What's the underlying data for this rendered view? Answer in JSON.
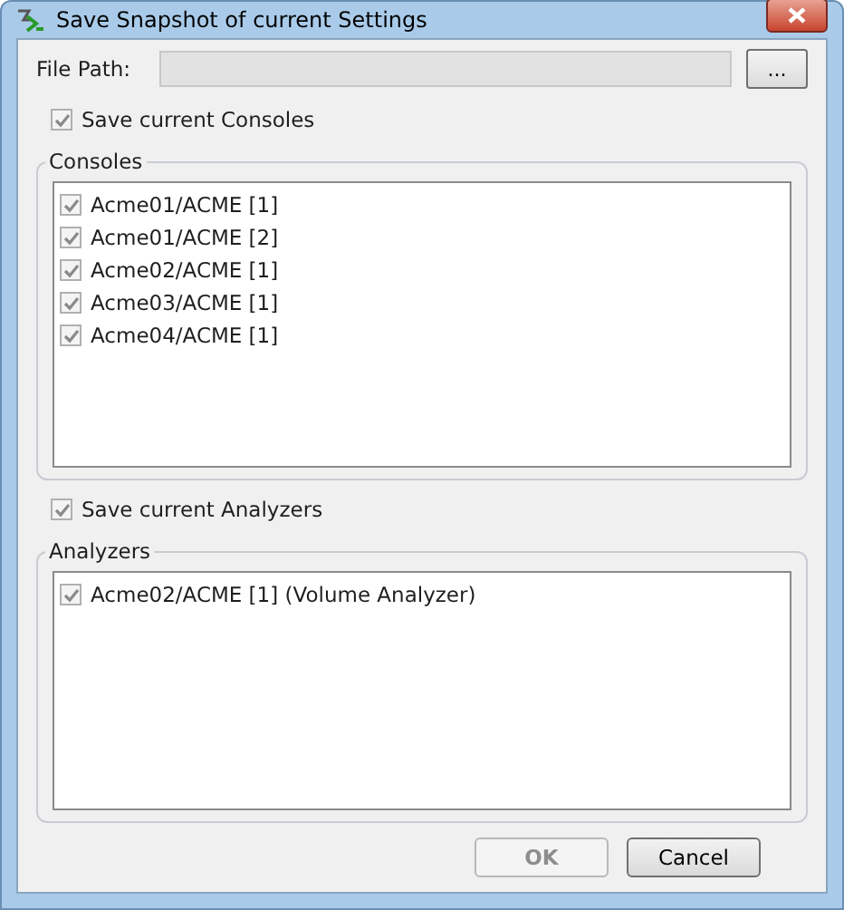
{
  "window": {
    "title": "Save Snapshot of current Settings"
  },
  "file_path": {
    "label": "File Path:",
    "disabled": true,
    "browse_button": "..."
  },
  "sections": [
    {
      "toggle": {
        "label": "Save current Consoles",
        "checked": true,
        "disabled": true
      },
      "group_title": "Consoles",
      "items": [
        {
          "label": "Acme01/ACME [1]",
          "checked": true,
          "disabled": true
        },
        {
          "label": "Acme01/ACME [2]",
          "checked": true,
          "disabled": true
        },
        {
          "label": "Acme02/ACME [1]",
          "checked": true,
          "disabled": true
        },
        {
          "label": "Acme03/ACME [1]",
          "checked": true,
          "disabled": true
        },
        {
          "label": "Acme04/ACME [1]",
          "checked": true,
          "disabled": true
        }
      ]
    },
    {
      "toggle": {
        "label": "Save current Analyzers",
        "checked": true,
        "disabled": true
      },
      "group_title": "Analyzers",
      "items": [
        {
          "label": "Acme02/ACME [1] (Volume Analyzer)",
          "checked": true,
          "disabled": true
        }
      ]
    }
  ],
  "buttons": [
    {
      "label": "OK",
      "disabled": true
    },
    {
      "label": "Cancel",
      "disabled": false
    }
  ]
}
